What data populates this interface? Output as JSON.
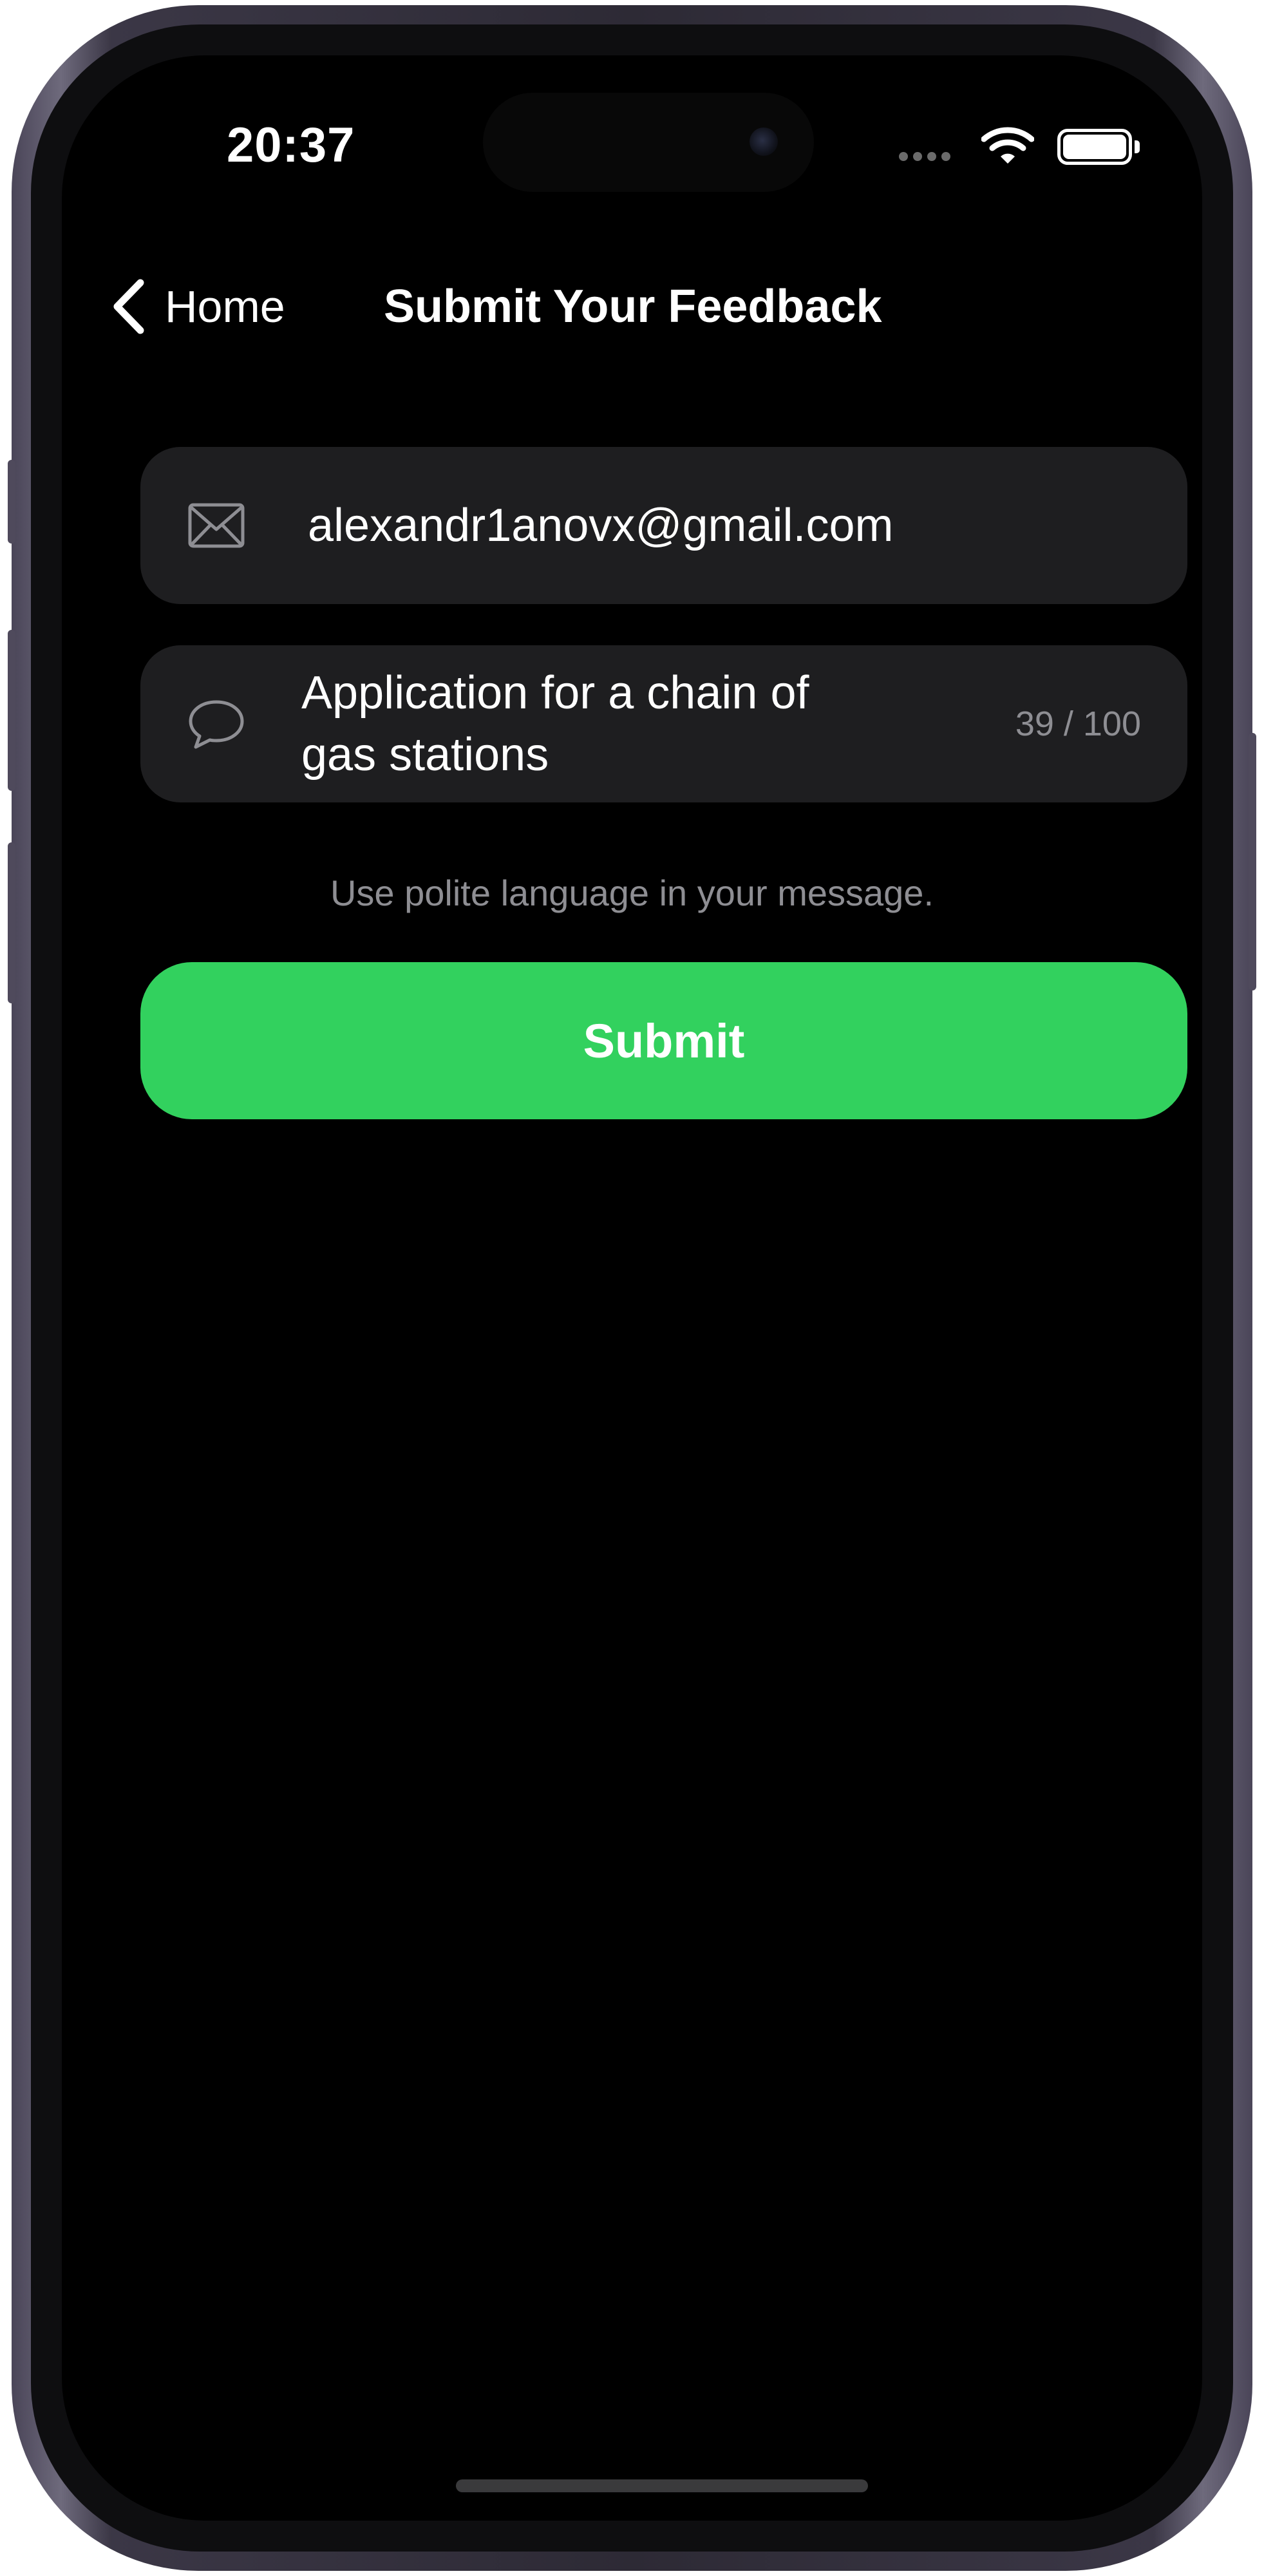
{
  "status_bar": {
    "time": "20:37",
    "battery_level": 1.0,
    "icons": [
      "cellular-signal-icon",
      "wifi-icon",
      "battery-icon"
    ]
  },
  "nav": {
    "back_label": "Home",
    "back_icon": "chevron-left-icon",
    "title": "Submit Your Feedback"
  },
  "form": {
    "email": {
      "icon": "envelope-icon",
      "value": "alexandr1anovx@gmail.com"
    },
    "message": {
      "icon": "speech-bubble-icon",
      "value": "Application for a chain of gas stations",
      "counter": "39 / 100"
    },
    "hint": "Use polite language in your message.",
    "submit_label": "Submit"
  },
  "colors": {
    "background": "#000000",
    "field_background": "#1e1e20",
    "accent_green": "#32d15e",
    "secondary_text": "#8e8e93"
  }
}
